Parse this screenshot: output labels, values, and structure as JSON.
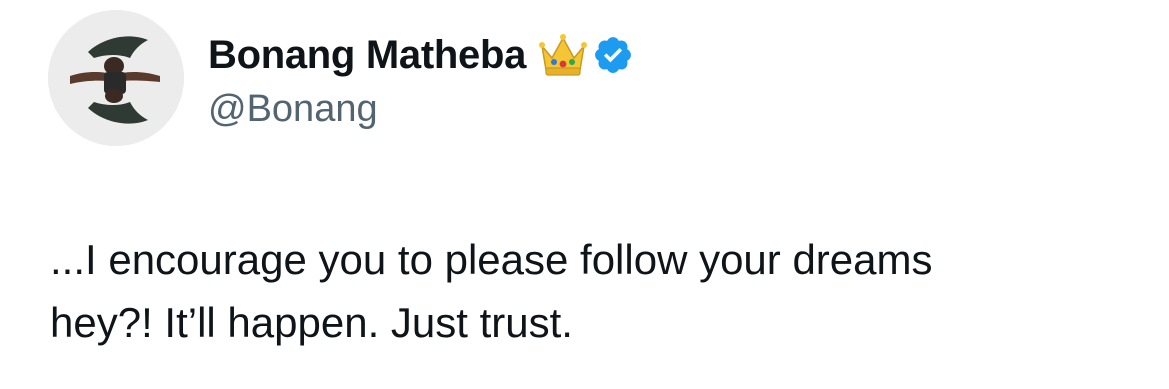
{
  "author": {
    "display_name": "Bonang Matheba",
    "handle": "@Bonang",
    "badges": [
      "crown-emoji-icon",
      "verified-badge-icon"
    ],
    "verified_color": "#1d9bf0"
  },
  "tweet": {
    "lines": [
      "...I encourage you to please follow your dreams",
      "hey?! It’ll happen. Just trust."
    ]
  },
  "colors": {
    "text": "#0f1419",
    "secondary_text": "#536471",
    "background": "#ffffff"
  }
}
